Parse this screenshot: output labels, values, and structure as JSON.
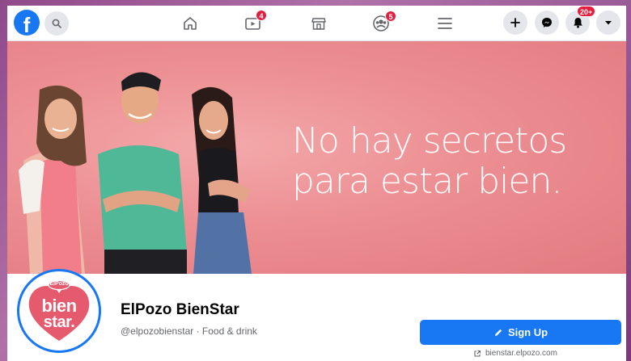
{
  "nav": {
    "logo_letter": "f",
    "badges": {
      "watch": "4",
      "groups": "5",
      "notifications": "20+"
    },
    "icons": [
      "facebook-logo",
      "search-icon",
      "home-icon",
      "watch-icon",
      "marketplace-icon",
      "groups-icon",
      "menu-icon",
      "plus-icon",
      "messenger-icon",
      "bell-icon",
      "chevron-down-icon"
    ]
  },
  "cover": {
    "headline_line1": "No hay secretos",
    "headline_line2": "para estar bien."
  },
  "avatar": {
    "brand_small": "ElPozo",
    "logo_line1": "bien",
    "logo_line2": "star."
  },
  "profile": {
    "name": "ElPozo BienStar",
    "subtitle": "@elpozobienstar · Food & drink"
  },
  "actions": {
    "signup_label": "Sign Up",
    "website": "bienstar.elpozo.com"
  },
  "colors": {
    "brand_blue": "#1877f2",
    "badge_red": "#e41e3f",
    "cover_pink": "#ec8e92",
    "logo_pink": "#e65a6e"
  }
}
